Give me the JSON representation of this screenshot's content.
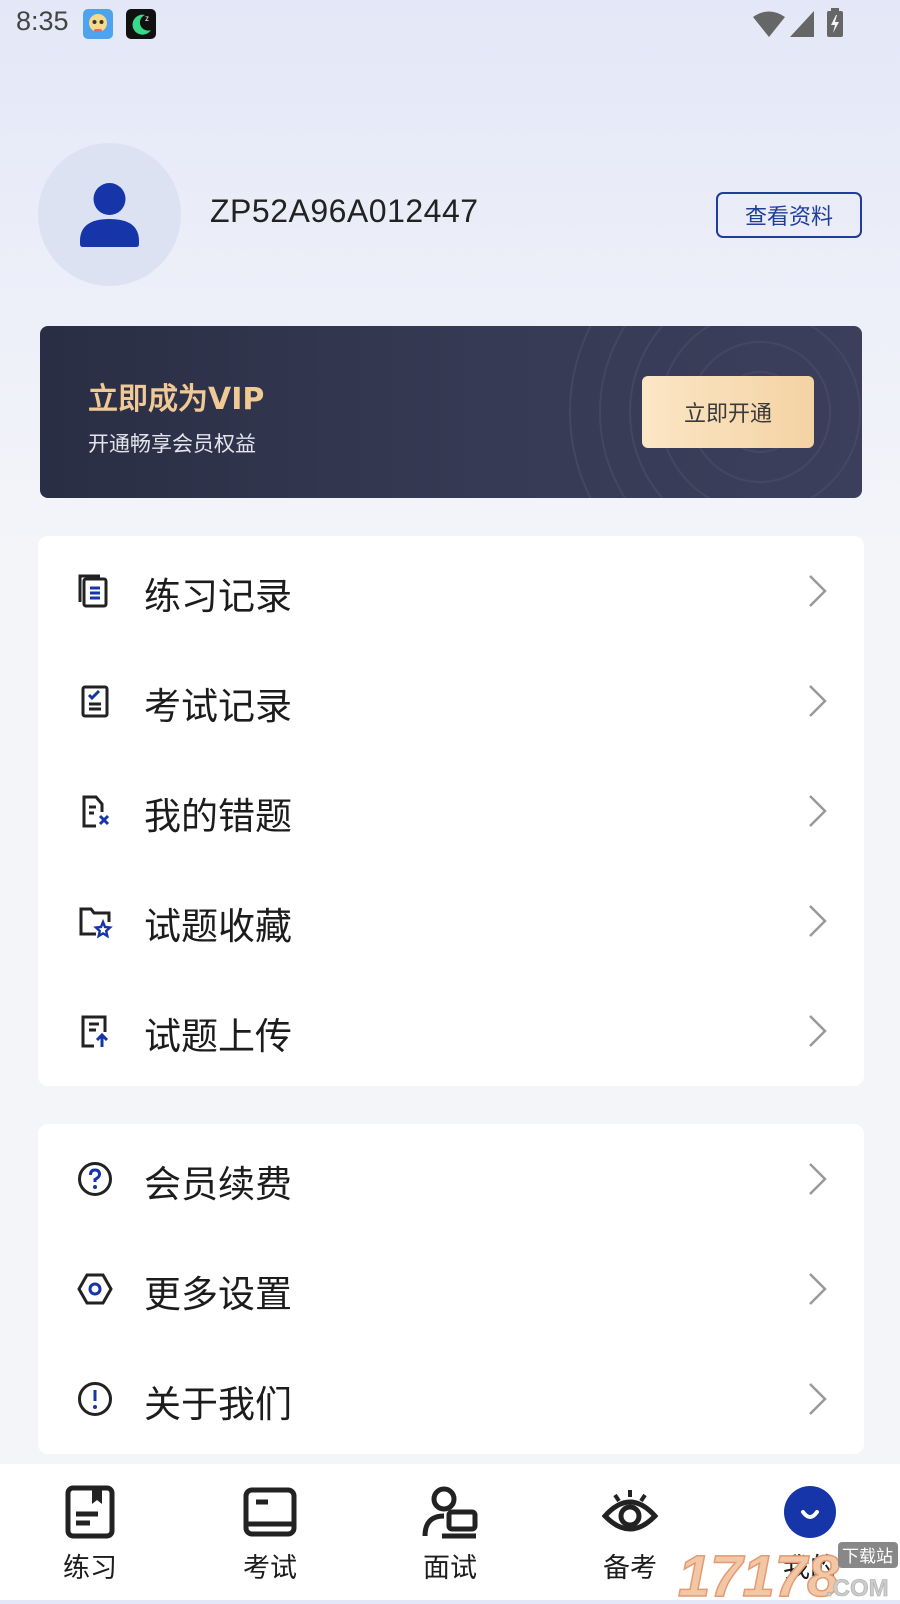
{
  "status_bar": {
    "time": "8:35",
    "notification_icons": [
      "app-notification-icon",
      "moon-sleep-icon"
    ],
    "system_icons": [
      "wifi-icon",
      "cellular-signal-icon",
      "battery-charging-icon"
    ]
  },
  "profile": {
    "avatar_icon": "user-icon",
    "username": "ZP52A96A012447",
    "view_profile_label": "查看资料"
  },
  "vip": {
    "title": "立即成为VIP",
    "subtitle": "开通畅享会员权益",
    "button_label": "立即开通"
  },
  "menu_group_1": [
    {
      "label": "练习记录",
      "icon": "practice-record-icon"
    },
    {
      "label": "考试记录",
      "icon": "exam-record-icon"
    },
    {
      "label": "我的错题",
      "icon": "wrong-questions-icon"
    },
    {
      "label": "试题收藏",
      "icon": "favorites-folder-icon"
    },
    {
      "label": "试题上传",
      "icon": "upload-question-icon"
    }
  ],
  "menu_group_2": [
    {
      "label": "会员续费",
      "icon": "help-circle-icon"
    },
    {
      "label": "更多设置",
      "icon": "settings-hexagon-icon"
    },
    {
      "label": "关于我们",
      "icon": "info-circle-icon"
    }
  ],
  "tabs": [
    {
      "label": "练习",
      "icon": "practice-book-icon",
      "active": false
    },
    {
      "label": "考试",
      "icon": "exam-book-icon",
      "active": false
    },
    {
      "label": "面试",
      "icon": "interview-icon",
      "active": false
    },
    {
      "label": "备考",
      "icon": "eye-icon",
      "active": false
    },
    {
      "label": "我的",
      "icon": "profile-face-icon",
      "active": true
    }
  ],
  "watermark": {
    "text": "17178",
    "badge": "下载站",
    "suffix": ".COM"
  },
  "colors": {
    "accent": "#1f3d99",
    "vip_gold": "#f0c995",
    "vip_bg": "#2f3349",
    "icon_dark": "#222222"
  }
}
